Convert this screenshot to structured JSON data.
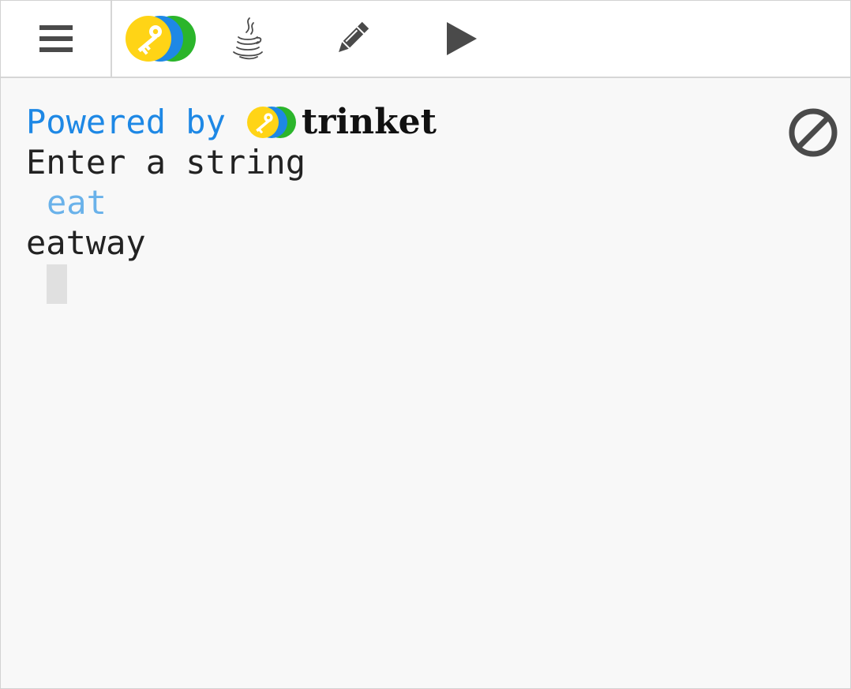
{
  "toolbar": {
    "menu_icon": "hamburger-menu-icon",
    "logo_icon": "trinket-logo-icon",
    "language_icon": "java-icon",
    "edit_icon": "pencil-icon",
    "run_icon": "play-icon"
  },
  "console": {
    "powered_by": "Powered by",
    "brand": "trinket",
    "prompt": "Enter a string",
    "user_input": "eat",
    "output": "eatway",
    "stop_icon": "stop-icon"
  },
  "colors": {
    "powered_by_blue": "#1e88e5",
    "input_text_blue": "#6ab2ea",
    "logo_yellow": "#ffd416",
    "logo_blue": "#1e88e5",
    "logo_green": "#2bb52b",
    "icon_gray": "#4a4a4a",
    "console_bg": "#f8f8f8"
  }
}
